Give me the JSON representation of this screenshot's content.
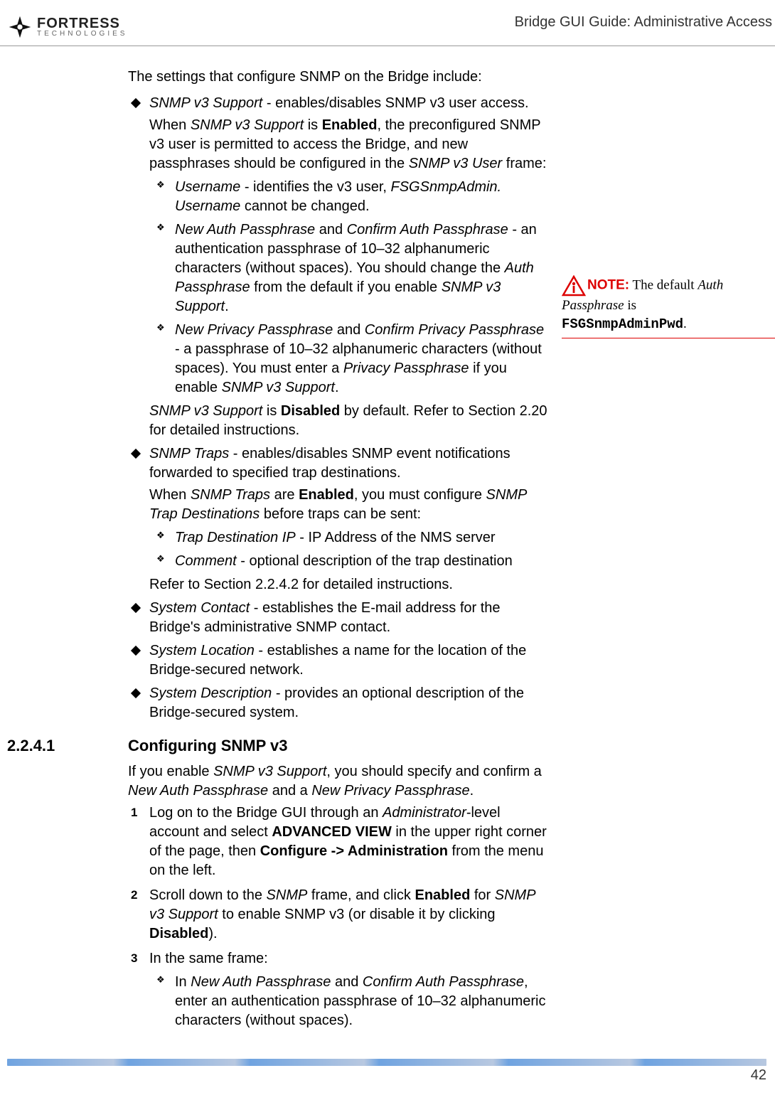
{
  "header": {
    "logo_main": "FORTRESS",
    "logo_sub": "TECHNOLOGIES",
    "title": "Bridge GUI Guide: Administrative Access"
  },
  "intro": "The settings that configure SNMP on the Bridge include:",
  "b1": {
    "lead_i": "SNMP v3 Support",
    "lead_r": " - enables/disables SNMP v3 user access.",
    "p1a": "When ",
    "p1b": "SNMP v3 Support",
    "p1c": " is ",
    "p1d": "Enabled",
    "p1e": ", the preconfigured SNMP v3 user is permitted to access the Bridge, and new passphrases should be configured in the ",
    "p1f": "SNMP v3 User",
    "p1g": " frame:",
    "s1a": "Username",
    "s1b": " - identifies the v3 user, ",
    "s1c": "FSGSnmpAdmin. Username",
    "s1d": " cannot be changed.",
    "s2a": "New Auth Passphrase",
    "s2b": " and ",
    "s2c": "Confirm Auth Passphrase",
    "s2d": " - an authentication passphrase of 10–32 alphanumeric characters (without spaces). You should change the ",
    "s2e": "Auth Passphrase",
    "s2f": " from the default if you enable ",
    "s2g": "SNMP v3 Support",
    "s2h": ".",
    "s3a": "New Privacy Passphrase",
    "s3b": " and ",
    "s3c": "Confirm Privacy Passphrase",
    "s3d": " - a passphrase of 10–32 alphanumeric characters (without spaces). You must enter a ",
    "s3e": "Privacy Passphrase",
    "s3f": " if you enable ",
    "s3g": "SNMP v3 Support",
    "s3h": ".",
    "p2a": "SNMP v3 Support",
    "p2b": " is ",
    "p2c": "Disabled",
    "p2d": " by default. Refer to Section 2.20 for detailed instructions."
  },
  "b2": {
    "lead_i": "SNMP Traps",
    "lead_r": " - enables/disables SNMP event notifications forwarded to specified trap destinations.",
    "p1a": "When ",
    "p1b": "SNMP Traps",
    "p1c": " are ",
    "p1d": "Enabled",
    "p1e": ", you must configure ",
    "p1f": "SNMP Trap Destinations",
    "p1g": " before traps can be sent:",
    "s1a": "Trap Destination IP",
    "s1b": " - IP Address of the NMS server",
    "s2a": "Comment",
    "s2b": " - optional description of the trap destination",
    "p2": "Refer to Section 2.2.4.2 for detailed instructions."
  },
  "b3": {
    "i": "System Contact",
    "r": " - establishes the E-mail address for the Bridge's administrative SNMP contact."
  },
  "b4": {
    "i": "System Location",
    "r": " - establishes a name for the location of the Bridge-secured network."
  },
  "b5": {
    "i": "System Description",
    "r": " - provides an optional description of the Bridge-secured system."
  },
  "section": {
    "num": "2.2.4.1",
    "title": "Configuring SNMP v3"
  },
  "section_intro": {
    "a": "If you enable ",
    "b": "SNMP v3 Support",
    "c": ", you should specify and confirm a ",
    "d": "New Auth Passphrase",
    "e": " and a ",
    "f": "New Privacy Passphrase",
    "g": "."
  },
  "step1": {
    "a": "Log on to the Bridge GUI through an ",
    "b": "Administrator",
    "c": "-level account and select ",
    "d": "ADVANCED VIEW",
    "e": " in the upper right corner of the page, then ",
    "f": "Configure -> Administration",
    "g": " from the menu on the left."
  },
  "step2": {
    "a": "Scroll down to the ",
    "b": "SNMP",
    "c": " frame, and click ",
    "d": "Enabled",
    "e": " for ",
    "f": "SNMP v3 Support",
    "g": " to enable SNMP v3 (or disable it by clicking ",
    "h": "Disabled",
    "i": ")."
  },
  "step3": {
    "lead": "In the same frame:",
    "s1a": "In ",
    "s1b": "New Auth Passphrase",
    "s1c": " and ",
    "s1d": "Confirm Auth Passphrase",
    "s1e": ", enter an authentication passphrase of 10–32 alphanumeric characters (without spaces)."
  },
  "note": {
    "label": "NOTE:",
    "t1": " The default ",
    "t2": "Auth Passphrase",
    "t3": " is ",
    "code": "FSGSnmpAdminPwd",
    "t4": "."
  },
  "page_number": "42"
}
